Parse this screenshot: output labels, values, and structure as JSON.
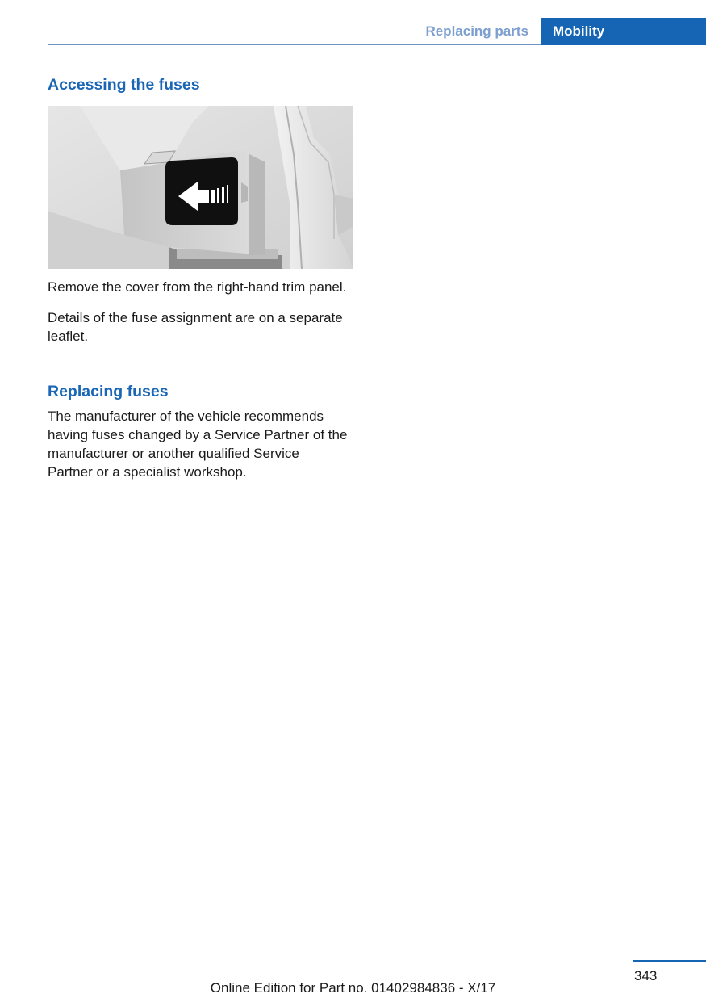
{
  "header": {
    "section": "Replacing parts",
    "chapter": "Mobility"
  },
  "section1": {
    "heading": "Accessing the fuses",
    "para1": "Remove the cover from the right-hand trim panel.",
    "para2": "Details of the fuse assignment are on a separate leaflet."
  },
  "section2": {
    "heading": "Replacing fuses",
    "para1": "The manufacturer of the vehicle recommends having fuses changed by a Service Partner of the manufacturer or another qualified Service Partner or a specialist workshop."
  },
  "footer": {
    "page_number": "343",
    "edition": "Online Edition for Part no. 01402984836 - X/17"
  }
}
